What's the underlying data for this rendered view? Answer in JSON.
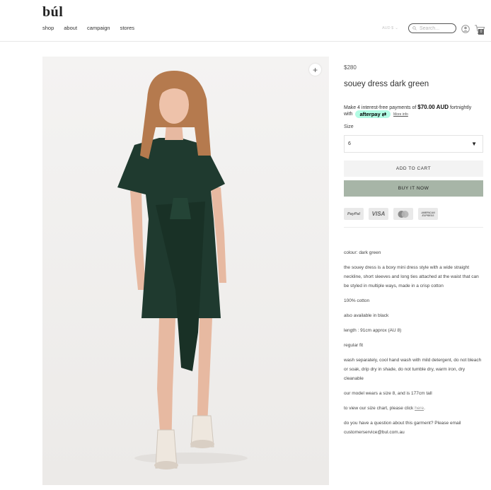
{
  "header": {
    "logo": "búl",
    "nav": [
      "shop",
      "about",
      "campaign",
      "stores"
    ],
    "currency": "AUD $",
    "search_placeholder": "Search...",
    "cart_count": "0"
  },
  "product": {
    "price": "$280",
    "title": "souey dress dark green",
    "afterpay_prefix": "Make 4 interest-free payments of ",
    "afterpay_amount": "$70.00 AUD",
    "afterpay_suffix": " fortnightly",
    "afterpay_with": "with",
    "afterpay_brand": "afterpay",
    "more_info": "More info",
    "size_label": "Size",
    "size_value": "6",
    "add_to_cart": "ADD TO CART",
    "buy_now": "BUY IT NOW",
    "payment_icons": [
      "PayPal",
      "VISA",
      "mastercard",
      "AMERICAN EXPRESS"
    ]
  },
  "description": {
    "colour": "colour: dark green",
    "body": "the souey dress is a boxy mini dress style with a wide straight neckline, short sleeves and long ties attached at the waist that can be styled in multiple ways, made in a crisp cotton",
    "fabric": "100% cotton",
    "also": "also available in black",
    "length": "length : 91cm approx (AU 8)",
    "fit": "regular fit",
    "care": "wash separately, cool hand wash with mild detergent, do not bleach or soak, drip dry in shade, do not tumble dry, warm iron, dry cleanable",
    "model": "our model wears a size 8, and is 177cm tall",
    "size_chart_prefix": "to view our size chart, please click ",
    "size_chart_link": "here",
    "size_chart_suffix": ".",
    "question": "do you have a question about this garment? Please email customerservice@bul.com.au"
  },
  "colors": {
    "buy_now_bg": "#a7b5a7",
    "afterpay_mint": "#b2fce4",
    "dress_green": "#1f3a2f"
  }
}
